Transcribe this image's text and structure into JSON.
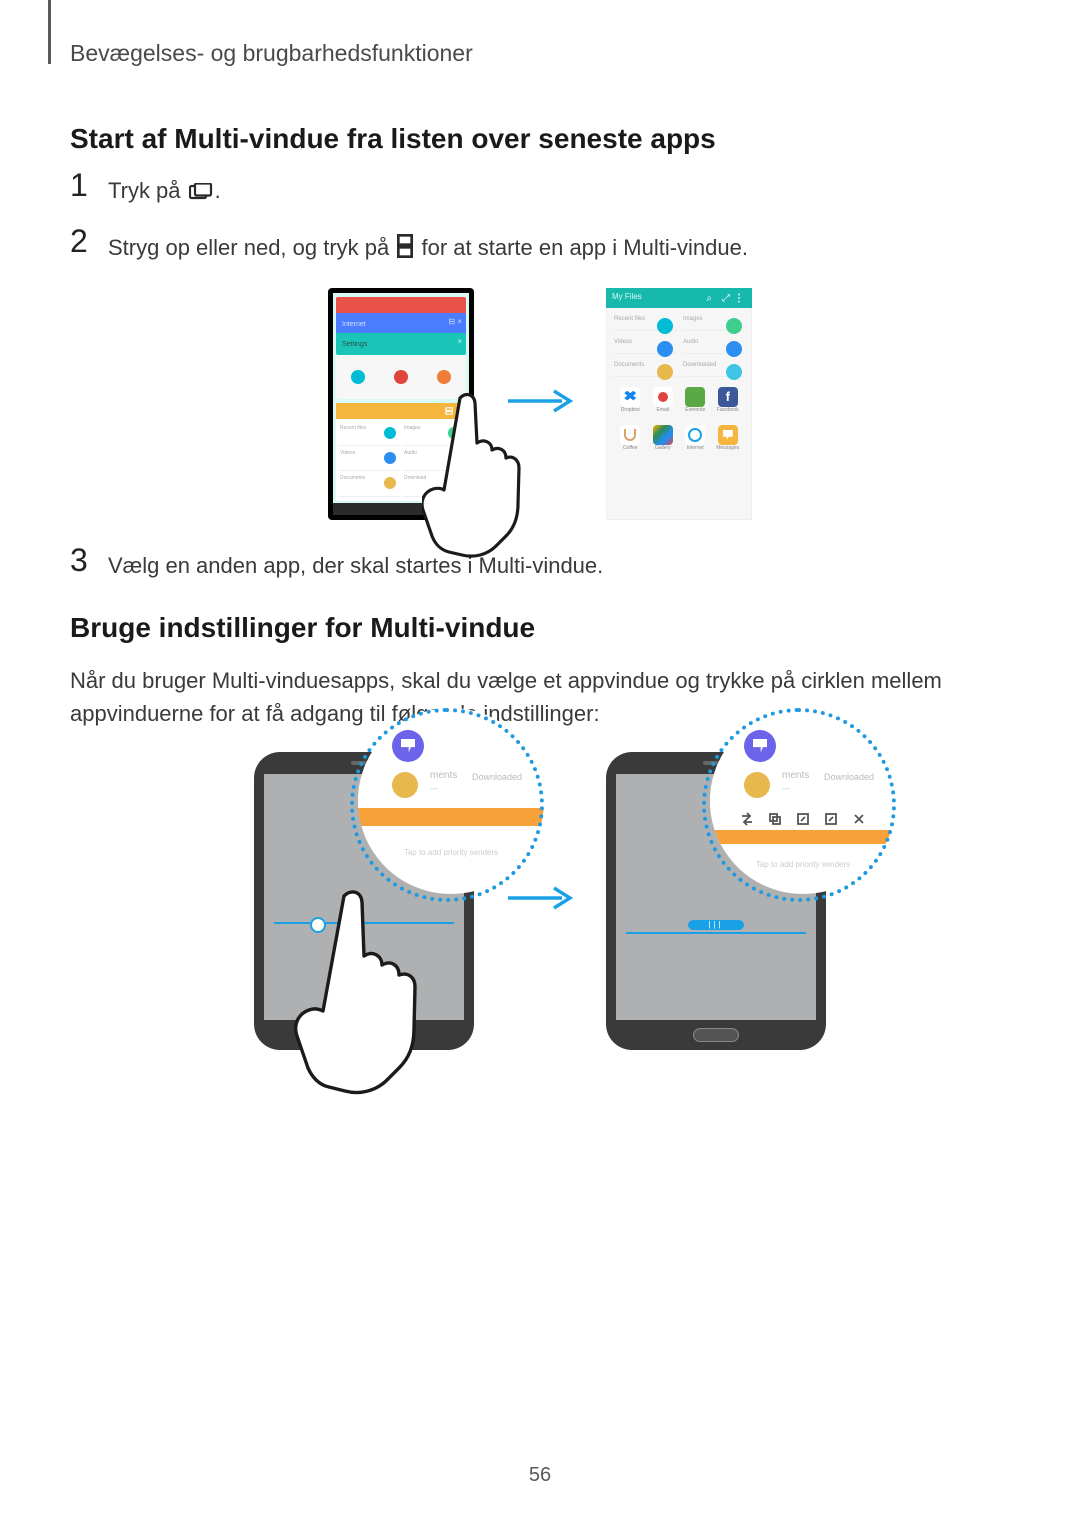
{
  "header": {
    "section": "Bevægelses- og brugbarhedsfunktioner"
  },
  "h3a": "Start af Multi-vindue fra listen over seneste apps",
  "steps": {
    "one": {
      "num": "1",
      "t1": "Tryk på ",
      "t2": "."
    },
    "two": {
      "num": "2",
      "t1": "Stryg op eller ned, og tryk på ",
      "t2": " for at starte en app i Multi-vindue."
    },
    "three": {
      "num": "3",
      "t1": "Vælg en anden app, der skal startes i Multi-vindue."
    }
  },
  "h3b": "Bruge indstillinger for Multi-vindue",
  "p1": "Når du bruger Multi-vinduesapps, skal du vælge et appvindue og trykke på cirklen mellem appvinduerne for at få adgang til følgende indstillinger:",
  "page_number": "56",
  "fig1": {
    "phone_cards": {
      "internet": "Internet",
      "settings": "Settings"
    },
    "panel": {
      "header": "My Files",
      "cells": [
        {
          "label": "Recent files",
          "sub": "",
          "icon": "target"
        },
        {
          "label": "Images",
          "sub": "",
          "icon": "pic"
        },
        {
          "label": "Videos",
          "sub": "",
          "icon": "vid"
        },
        {
          "label": "Audio",
          "sub": "",
          "icon": "music"
        },
        {
          "label": "Documents",
          "sub": "",
          "icon": "doc"
        },
        {
          "label": "Downloaded",
          "sub": "",
          "icon": "dl"
        }
      ],
      "apps_row1": [
        {
          "label": "Dropbox",
          "cls": "dropbox"
        },
        {
          "label": "Email",
          "cls": "rec"
        },
        {
          "label": "Evernote",
          "cls": "ever"
        },
        {
          "label": "Facebook",
          "cls": "fb",
          "text": "f"
        }
      ],
      "apps_row2": [
        {
          "label": "Coffee",
          "cls": "cup"
        },
        {
          "label": "Gallery",
          "cls": "gal"
        },
        {
          "label": "Internet",
          "cls": "net"
        },
        {
          "label": "Messages",
          "cls": "msg"
        }
      ]
    }
  },
  "fig2": {
    "zoom": {
      "mid_label": "ments",
      "mid_right": "Downloaded",
      "hint": "Tap to add priority senders"
    }
  },
  "icons": {
    "recent": "recent-apps-icon",
    "multiwin": "multi-window-icon",
    "search": "search-icon",
    "expand": "expand-icon",
    "more": "more-icon"
  }
}
